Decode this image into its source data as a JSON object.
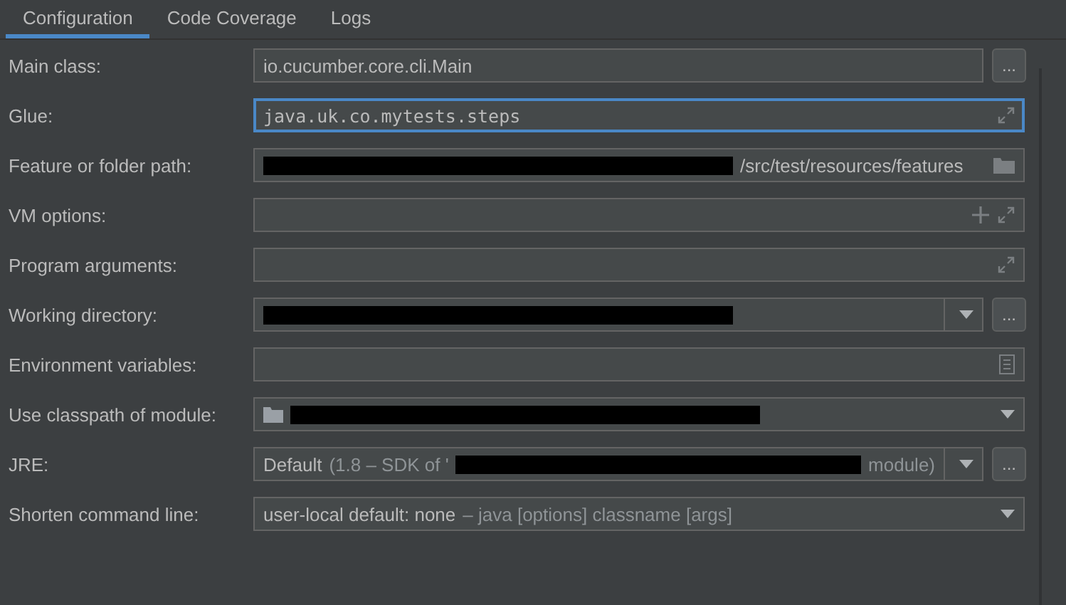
{
  "tabs": [
    {
      "label": "Configuration",
      "selected": true
    },
    {
      "label": "Code Coverage",
      "selected": false
    },
    {
      "label": "Logs",
      "selected": false
    }
  ],
  "rows": [
    {
      "label": "Main class:",
      "focused": false,
      "mono": false,
      "dropdown": false,
      "browse_button": "...",
      "value": [
        {
          "kind": "text",
          "text": "io.cucumber.core.cli.Main"
        }
      ]
    },
    {
      "label": "Glue:",
      "focused": true,
      "mono": true,
      "dropdown": false,
      "value": [
        {
          "kind": "text",
          "text": "java.uk.co.mytests.steps"
        }
      ],
      "icons": [
        {
          "kind": "expand"
        }
      ]
    },
    {
      "label": "Feature or folder path:",
      "focused": false,
      "mono": false,
      "dropdown": false,
      "value": [
        {
          "kind": "redacted"
        },
        {
          "kind": "text",
          "text": "/src/test/resources/features"
        }
      ],
      "icons": [
        {
          "kind": "folder"
        }
      ]
    },
    {
      "label": "VM options:",
      "focused": false,
      "dropdown": false,
      "icons": [
        {
          "kind": "plus"
        },
        {
          "kind": "expand"
        }
      ]
    },
    {
      "label": "Program arguments:",
      "focused": false,
      "dropdown": false,
      "icons": [
        {
          "kind": "expand"
        }
      ]
    },
    {
      "label": "Working directory:",
      "focused": false,
      "mono": false,
      "dropdown": true,
      "browse_button": "...",
      "value": [
        {
          "kind": "redacted"
        }
      ]
    },
    {
      "label": "Environment variables:",
      "focused": false,
      "dropdown": false,
      "icons": [
        {
          "kind": "document"
        }
      ]
    },
    {
      "label": "Use classpath of module:",
      "focused": false,
      "mono": false,
      "dropdown": true,
      "value": [
        {
          "kind": "module"
        },
        {
          "kind": "redacted"
        }
      ]
    },
    {
      "label": "JRE:",
      "focused": false,
      "mono": false,
      "dropdown": true,
      "browse_button": "...",
      "value": [
        {
          "kind": "text",
          "text": "Default"
        },
        {
          "kind": "dim",
          "text": "(1.8 – SDK of '"
        },
        {
          "kind": "redacted"
        },
        {
          "kind": "dim",
          "text": "module)"
        }
      ]
    },
    {
      "label": "Shorten command line:",
      "focused": false,
      "mono": false,
      "dropdown": true,
      "value": [
        {
          "kind": "text",
          "text": "user-local default: none"
        },
        {
          "kind": "dim",
          "text": "– java [options] classname [args]"
        }
      ]
    }
  ]
}
